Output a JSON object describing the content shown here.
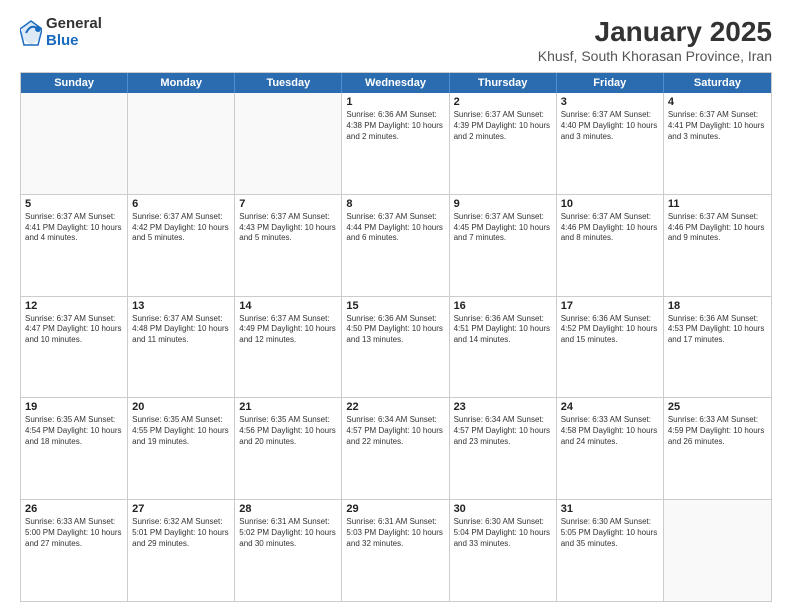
{
  "logo": {
    "general": "General",
    "blue": "Blue"
  },
  "title": "January 2025",
  "subtitle": "Khusf, South Khorasan Province, Iran",
  "weekdays": [
    "Sunday",
    "Monday",
    "Tuesday",
    "Wednesday",
    "Thursday",
    "Friday",
    "Saturday"
  ],
  "weeks": [
    [
      {
        "day": "",
        "info": ""
      },
      {
        "day": "",
        "info": ""
      },
      {
        "day": "",
        "info": ""
      },
      {
        "day": "1",
        "info": "Sunrise: 6:36 AM\nSunset: 4:38 PM\nDaylight: 10 hours\nand 2 minutes."
      },
      {
        "day": "2",
        "info": "Sunrise: 6:37 AM\nSunset: 4:39 PM\nDaylight: 10 hours\nand 2 minutes."
      },
      {
        "day": "3",
        "info": "Sunrise: 6:37 AM\nSunset: 4:40 PM\nDaylight: 10 hours\nand 3 minutes."
      },
      {
        "day": "4",
        "info": "Sunrise: 6:37 AM\nSunset: 4:41 PM\nDaylight: 10 hours\nand 3 minutes."
      }
    ],
    [
      {
        "day": "5",
        "info": "Sunrise: 6:37 AM\nSunset: 4:41 PM\nDaylight: 10 hours\nand 4 minutes."
      },
      {
        "day": "6",
        "info": "Sunrise: 6:37 AM\nSunset: 4:42 PM\nDaylight: 10 hours\nand 5 minutes."
      },
      {
        "day": "7",
        "info": "Sunrise: 6:37 AM\nSunset: 4:43 PM\nDaylight: 10 hours\nand 5 minutes."
      },
      {
        "day": "8",
        "info": "Sunrise: 6:37 AM\nSunset: 4:44 PM\nDaylight: 10 hours\nand 6 minutes."
      },
      {
        "day": "9",
        "info": "Sunrise: 6:37 AM\nSunset: 4:45 PM\nDaylight: 10 hours\nand 7 minutes."
      },
      {
        "day": "10",
        "info": "Sunrise: 6:37 AM\nSunset: 4:46 PM\nDaylight: 10 hours\nand 8 minutes."
      },
      {
        "day": "11",
        "info": "Sunrise: 6:37 AM\nSunset: 4:46 PM\nDaylight: 10 hours\nand 9 minutes."
      }
    ],
    [
      {
        "day": "12",
        "info": "Sunrise: 6:37 AM\nSunset: 4:47 PM\nDaylight: 10 hours\nand 10 minutes."
      },
      {
        "day": "13",
        "info": "Sunrise: 6:37 AM\nSunset: 4:48 PM\nDaylight: 10 hours\nand 11 minutes."
      },
      {
        "day": "14",
        "info": "Sunrise: 6:37 AM\nSunset: 4:49 PM\nDaylight: 10 hours\nand 12 minutes."
      },
      {
        "day": "15",
        "info": "Sunrise: 6:36 AM\nSunset: 4:50 PM\nDaylight: 10 hours\nand 13 minutes."
      },
      {
        "day": "16",
        "info": "Sunrise: 6:36 AM\nSunset: 4:51 PM\nDaylight: 10 hours\nand 14 minutes."
      },
      {
        "day": "17",
        "info": "Sunrise: 6:36 AM\nSunset: 4:52 PM\nDaylight: 10 hours\nand 15 minutes."
      },
      {
        "day": "18",
        "info": "Sunrise: 6:36 AM\nSunset: 4:53 PM\nDaylight: 10 hours\nand 17 minutes."
      }
    ],
    [
      {
        "day": "19",
        "info": "Sunrise: 6:35 AM\nSunset: 4:54 PM\nDaylight: 10 hours\nand 18 minutes."
      },
      {
        "day": "20",
        "info": "Sunrise: 6:35 AM\nSunset: 4:55 PM\nDaylight: 10 hours\nand 19 minutes."
      },
      {
        "day": "21",
        "info": "Sunrise: 6:35 AM\nSunset: 4:56 PM\nDaylight: 10 hours\nand 20 minutes."
      },
      {
        "day": "22",
        "info": "Sunrise: 6:34 AM\nSunset: 4:57 PM\nDaylight: 10 hours\nand 22 minutes."
      },
      {
        "day": "23",
        "info": "Sunrise: 6:34 AM\nSunset: 4:57 PM\nDaylight: 10 hours\nand 23 minutes."
      },
      {
        "day": "24",
        "info": "Sunrise: 6:33 AM\nSunset: 4:58 PM\nDaylight: 10 hours\nand 24 minutes."
      },
      {
        "day": "25",
        "info": "Sunrise: 6:33 AM\nSunset: 4:59 PM\nDaylight: 10 hours\nand 26 minutes."
      }
    ],
    [
      {
        "day": "26",
        "info": "Sunrise: 6:33 AM\nSunset: 5:00 PM\nDaylight: 10 hours\nand 27 minutes."
      },
      {
        "day": "27",
        "info": "Sunrise: 6:32 AM\nSunset: 5:01 PM\nDaylight: 10 hours\nand 29 minutes."
      },
      {
        "day": "28",
        "info": "Sunrise: 6:31 AM\nSunset: 5:02 PM\nDaylight: 10 hours\nand 30 minutes."
      },
      {
        "day": "29",
        "info": "Sunrise: 6:31 AM\nSunset: 5:03 PM\nDaylight: 10 hours\nand 32 minutes."
      },
      {
        "day": "30",
        "info": "Sunrise: 6:30 AM\nSunset: 5:04 PM\nDaylight: 10 hours\nand 33 minutes."
      },
      {
        "day": "31",
        "info": "Sunrise: 6:30 AM\nSunset: 5:05 PM\nDaylight: 10 hours\nand 35 minutes."
      },
      {
        "day": "",
        "info": ""
      }
    ]
  ]
}
